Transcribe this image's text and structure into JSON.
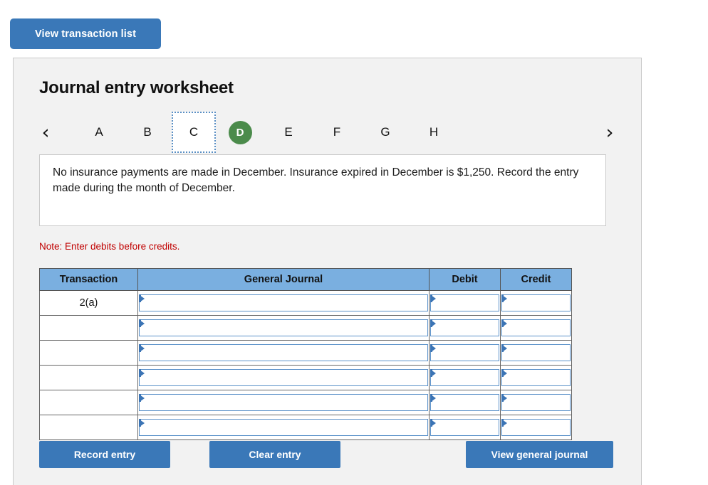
{
  "top": {
    "view_transaction_list": "View transaction list"
  },
  "panel": {
    "title": "Journal entry worksheet"
  },
  "tabstrip": {
    "prev_icon": "‹",
    "next_icon": "›",
    "tabs": [
      {
        "label": "A",
        "state": "normal"
      },
      {
        "label": "B",
        "state": "normal"
      },
      {
        "label": "C",
        "state": "focused"
      },
      {
        "label": "D",
        "state": "active"
      },
      {
        "label": "E",
        "state": "normal"
      },
      {
        "label": "F",
        "state": "normal"
      },
      {
        "label": "G",
        "state": "normal"
      },
      {
        "label": "H",
        "state": "normal"
      }
    ]
  },
  "instruction": {
    "text": "No insurance payments are made in December. Insurance expired in December is $1,250. Record the entry made during the month of December."
  },
  "note": {
    "text": "Note: Enter debits before credits."
  },
  "table": {
    "headers": {
      "transaction": "Transaction",
      "general_journal": "General Journal",
      "debit": "Debit",
      "credit": "Credit"
    },
    "rows": [
      {
        "transaction": "2(a)",
        "general_journal": "",
        "debit": "",
        "credit": ""
      },
      {
        "transaction": "",
        "general_journal": "",
        "debit": "",
        "credit": ""
      },
      {
        "transaction": "",
        "general_journal": "",
        "debit": "",
        "credit": ""
      },
      {
        "transaction": "",
        "general_journal": "",
        "debit": "",
        "credit": ""
      },
      {
        "transaction": "",
        "general_journal": "",
        "debit": "",
        "credit": ""
      },
      {
        "transaction": "",
        "general_journal": "",
        "debit": "",
        "credit": ""
      }
    ]
  },
  "actions": {
    "record_entry": "Record entry",
    "clear_entry": "Clear entry",
    "view_general_journal": "View general journal"
  },
  "colors": {
    "button_blue": "#3a78b8",
    "header_blue": "#7aafe0",
    "active_tab_green": "#4b8b4b",
    "note_red": "#c00000",
    "panel_bg": "#f2f2f2",
    "input_border_blue": "#5b91c9"
  }
}
